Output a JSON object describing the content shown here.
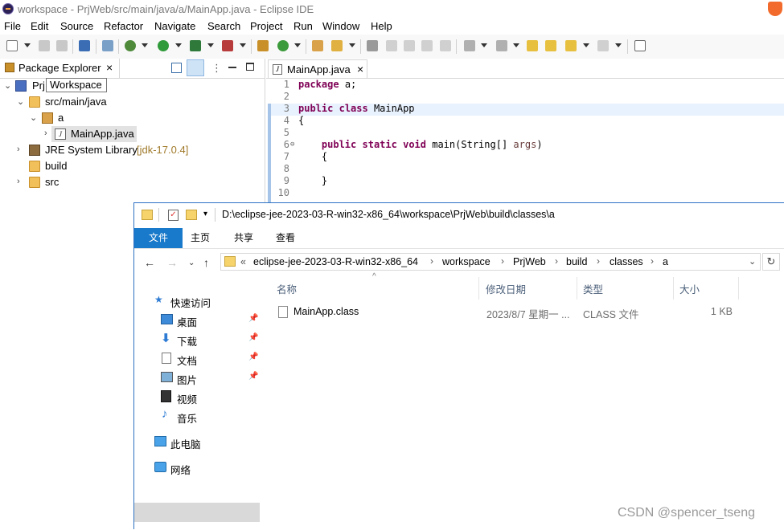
{
  "eclipse": {
    "title": "workspace - PrjWeb/src/main/java/a/MainApp.java - Eclipse IDE",
    "menu": [
      "File",
      "Edit",
      "Source",
      "Refactor",
      "Navigate",
      "Search",
      "Project",
      "Run",
      "Window",
      "Help"
    ],
    "package_explorer": {
      "tab_label": "Package Explorer",
      "tooltip": "Workspace",
      "tree": [
        {
          "label": "Prj",
          "icon": "project-icon",
          "expanded": true
        },
        {
          "label": "src/main/java",
          "icon": "source-folder-icon",
          "expanded": true
        },
        {
          "label": "a",
          "icon": "package-icon",
          "expanded": true
        },
        {
          "label": "MainApp.java",
          "icon": "java-file-icon",
          "expanded": false
        },
        {
          "label": "JRE System Library",
          "suffix": "[jdk-17.0.4]",
          "icon": "library-icon",
          "expanded": false
        },
        {
          "label": "build",
          "icon": "folder-icon",
          "expanded": null
        },
        {
          "label": "src",
          "icon": "folder-icon",
          "expanded": false
        }
      ]
    },
    "editor": {
      "tab_label": "MainApp.java",
      "lines": [
        {
          "n": "1",
          "code": "package a;"
        },
        {
          "n": "2",
          "code": ""
        },
        {
          "n": "3",
          "code": "public class MainApp"
        },
        {
          "n": "4",
          "code": "{"
        },
        {
          "n": "5",
          "code": ""
        },
        {
          "n": "6",
          "code": "    public static void main(String[] args)"
        },
        {
          "n": "7",
          "code": "    {"
        },
        {
          "n": "8",
          "code": ""
        },
        {
          "n": "9",
          "code": "    }"
        },
        {
          "n": "10",
          "code": ""
        }
      ]
    }
  },
  "explorer": {
    "path": "D:\\eclipse-jee-2023-03-R-win32-x86_64\\workspace\\PrjWeb\\build\\classes\\a",
    "ribbon_tabs": [
      "文件",
      "主页",
      "共享",
      "查看"
    ],
    "breadcrumb_prefix": "«",
    "breadcrumbs": [
      "eclipse-jee-2023-03-R-win32-x86_64",
      "workspace",
      "PrjWeb",
      "build",
      "classes",
      "a"
    ],
    "nav_items": [
      {
        "label": "快速访问",
        "icon": "star-icon",
        "pinned": false
      },
      {
        "label": "桌面",
        "icon": "desktop-icon",
        "pinned": true
      },
      {
        "label": "下载",
        "icon": "download-icon",
        "pinned": true
      },
      {
        "label": "文档",
        "icon": "document-icon",
        "pinned": true
      },
      {
        "label": "图片",
        "icon": "picture-icon",
        "pinned": true
      },
      {
        "label": "视频",
        "icon": "video-icon",
        "pinned": false
      },
      {
        "label": "音乐",
        "icon": "music-icon",
        "pinned": false
      },
      {
        "label": "此电脑",
        "icon": "computer-icon",
        "pinned": false,
        "selected": true
      },
      {
        "label": "网络",
        "icon": "network-icon",
        "pinned": false
      }
    ],
    "columns": [
      "名称",
      "修改日期",
      "类型",
      "大小"
    ],
    "files": [
      {
        "name": "MainApp.class",
        "modified": "2023/8/7 星期一 ...",
        "type": "CLASS 文件",
        "size": "1 KB"
      }
    ]
  },
  "watermark": "CSDN @spencer_tseng",
  "colors": {
    "accent": "#1979ca",
    "keyword": "#7f0055",
    "line_highlight": "#e8f2fe"
  }
}
